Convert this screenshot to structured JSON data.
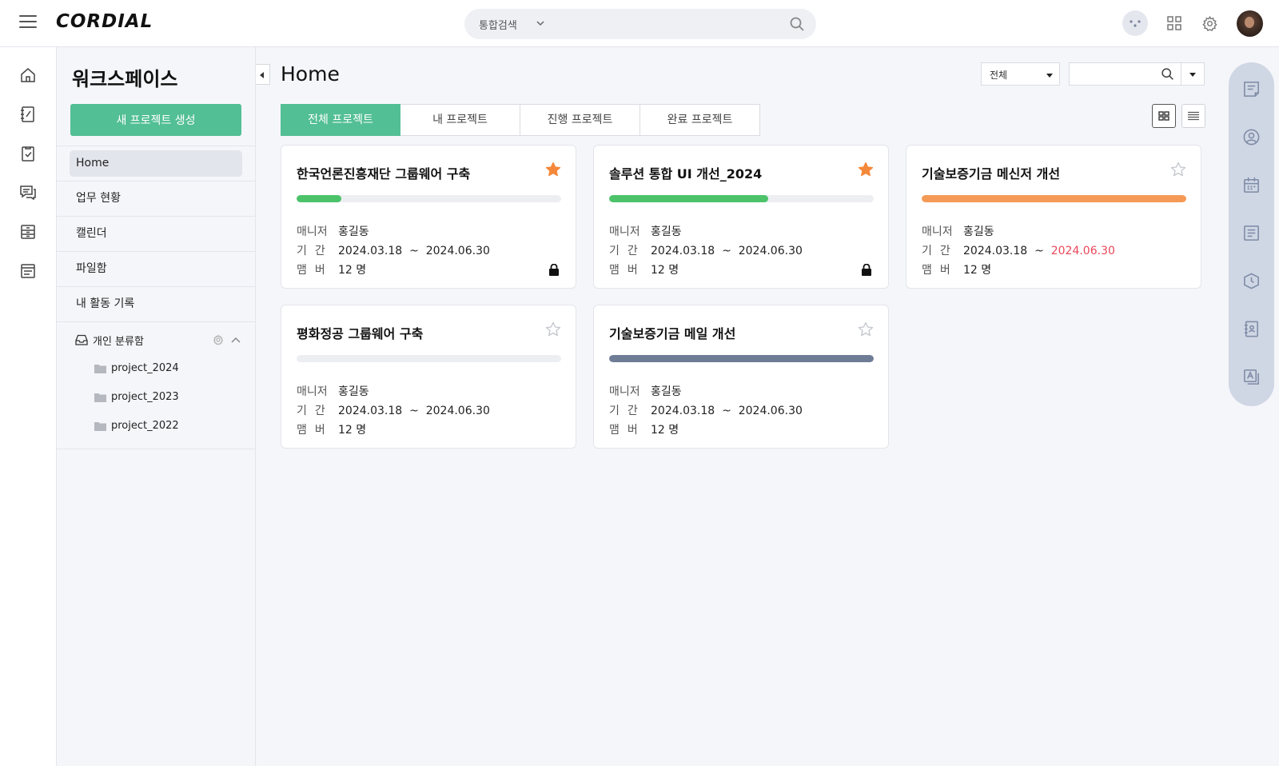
{
  "app": {
    "logo": "CORDIAL"
  },
  "header": {
    "search_scope": "통합검색"
  },
  "sidebar": {
    "title": "워크스페이스",
    "new_project_button": "새 프로젝트 생성",
    "items": [
      {
        "label": "Home",
        "active": true
      },
      {
        "label": "업무 현황",
        "active": false
      },
      {
        "label": "캘린더",
        "active": false
      },
      {
        "label": "파일함",
        "active": false
      },
      {
        "label": "내 활동 기록",
        "active": false
      }
    ],
    "inbox": {
      "label": "개인 분류함",
      "folders": [
        "project_2024",
        "project_2023",
        "project_2022"
      ]
    }
  },
  "main": {
    "title": "Home",
    "filter_value": "전체",
    "tabs": [
      {
        "label": "전체 프로젝트",
        "active": true
      },
      {
        "label": "내 프로젝트",
        "active": false
      },
      {
        "label": "진행 프로젝트",
        "active": false
      },
      {
        "label": "완료 프로젝트",
        "active": false
      }
    ],
    "labels": {
      "manager": "매니저",
      "period": "기간",
      "members": "맴버",
      "tilde": "~"
    },
    "cards": [
      {
        "title": "한국언론진흥재단 그룹웨어 구축",
        "starred": true,
        "progress": 0.17,
        "progress_color": "#4cc36a",
        "manager": "홍길동",
        "start": "2024.03.18",
        "end": "2024.06.30",
        "overdue": false,
        "members": "12 명",
        "locked": true
      },
      {
        "title": "솔루션 통합 UI 개선_2024",
        "starred": true,
        "progress": 0.6,
        "progress_color": "#4cc36a",
        "manager": "홍길동",
        "start": "2024.03.18",
        "end": "2024.06.30",
        "overdue": false,
        "members": "12 명",
        "locked": true
      },
      {
        "title": "기술보증기금 메신저 개선",
        "starred": false,
        "progress": 1.0,
        "progress_color": "#f59a56",
        "manager": "홍길동",
        "start": "2024.03.18",
        "end": "2024.06.30",
        "overdue": true,
        "members": "12 명",
        "locked": false
      },
      {
        "title": "평화정공 그룹웨어 구축",
        "starred": false,
        "progress": 0.0,
        "progress_color": "#4cc36a",
        "manager": "홍길동",
        "start": "2024.03.18",
        "end": "2024.06.30",
        "overdue": false,
        "members": "12 명",
        "locked": false
      },
      {
        "title": "기술보증기금 메일 개선",
        "starred": false,
        "progress": 1.0,
        "progress_color": "#6f7c96",
        "manager": "홍길동",
        "start": "2024.03.18",
        "end": "2024.06.30",
        "overdue": false,
        "members": "12 명",
        "locked": false
      }
    ]
  },
  "colors": {
    "accent": "#53bf95",
    "star": "#f5883a",
    "overdue": "#e8475a"
  }
}
